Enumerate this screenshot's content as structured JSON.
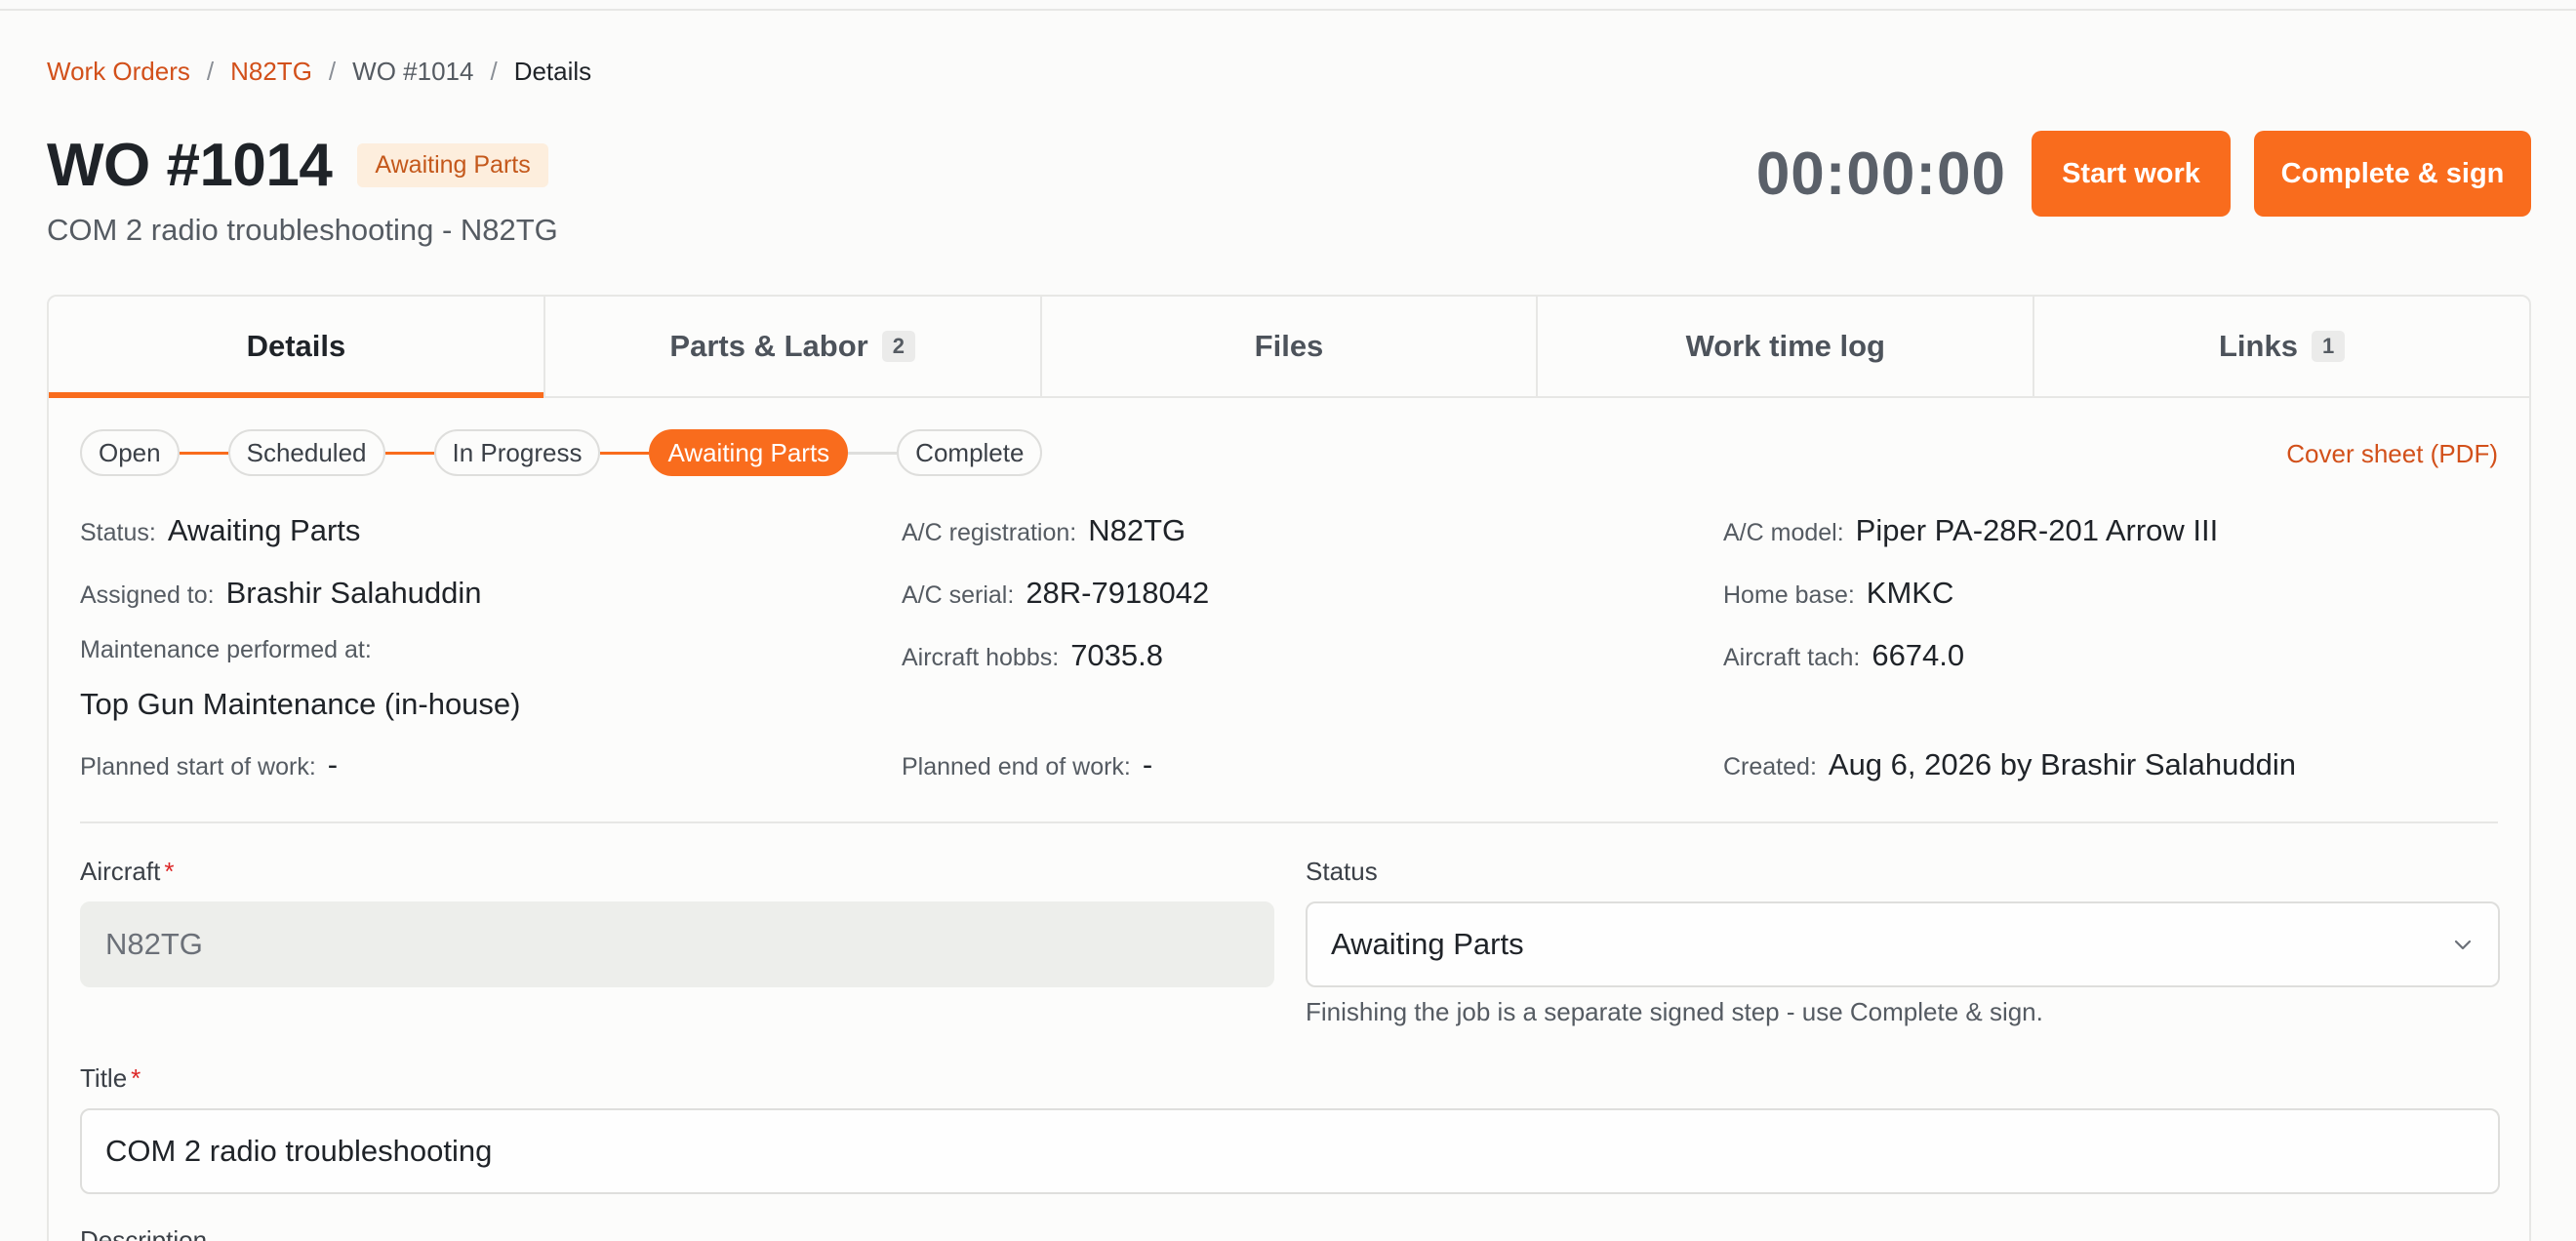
{
  "breadcrumb": {
    "items": [
      "Work Orders",
      "N82TG",
      "WO #1014",
      "Details"
    ],
    "separator": "/"
  },
  "header": {
    "title": "WO #1014",
    "status_badge": "Awaiting Parts",
    "subtitle": "COM 2 radio troubleshooting - N82TG",
    "timer": "00:00:00",
    "start_label": "Start work",
    "complete_label": "Complete & sign"
  },
  "tabs": [
    {
      "label": "Details",
      "count": null,
      "active": true
    },
    {
      "label": "Parts & Labor",
      "count": "2"
    },
    {
      "label": "Files",
      "count": null
    },
    {
      "label": "Work time log",
      "count": null
    },
    {
      "label": "Links",
      "count": "1"
    }
  ],
  "stepper": {
    "steps": [
      "Open",
      "Scheduled",
      "In Progress",
      "Awaiting Parts",
      "Complete"
    ],
    "current": "Awaiting Parts"
  },
  "cover_sheet_label": "Cover sheet (PDF)",
  "info": {
    "status": {
      "label": "Status:",
      "value": "Awaiting Parts"
    },
    "assigned": {
      "label": "Assigned to:",
      "value": "Brashir Salahuddin"
    },
    "performed_at": {
      "label": "Maintenance performed at:",
      "value": "Top Gun Maintenance (in-house)"
    },
    "planned_start": {
      "label": "Planned start of work:",
      "value": "-"
    },
    "registration": {
      "label": "A/C registration:",
      "value": "N82TG"
    },
    "serial": {
      "label": "A/C serial:",
      "value": "28R-7918042"
    },
    "hobbs": {
      "label": "Aircraft hobbs:",
      "value": "7035.8"
    },
    "planned_end": {
      "label": "Planned end of work:",
      "value": "-"
    },
    "model": {
      "label": "A/C model:",
      "value": "Piper PA-28R-201 Arrow III"
    },
    "home_base": {
      "label": "Home base:",
      "value": "KMKC"
    },
    "tach": {
      "label": "Aircraft tach:",
      "value": "6674.0"
    },
    "created": {
      "label": "Created:",
      "value": "Aug 6, 2026 by Brashir Salahuddin"
    }
  },
  "form": {
    "aircraft": {
      "label": "Aircraft",
      "required_mark": "*",
      "value": "N82TG"
    },
    "status": {
      "label": "Status",
      "value": "Awaiting Parts",
      "help": "Finishing the job is a separate signed step - use Complete & sign."
    },
    "title": {
      "label": "Title",
      "required_mark": "*",
      "value": "COM 2 radio troubleshooting"
    },
    "description": {
      "label": "Description"
    }
  },
  "colors": {
    "accent": "#f96c1d",
    "link": "#d2501a",
    "badge_bg": "#fdeedd",
    "required": "#dc2626"
  }
}
